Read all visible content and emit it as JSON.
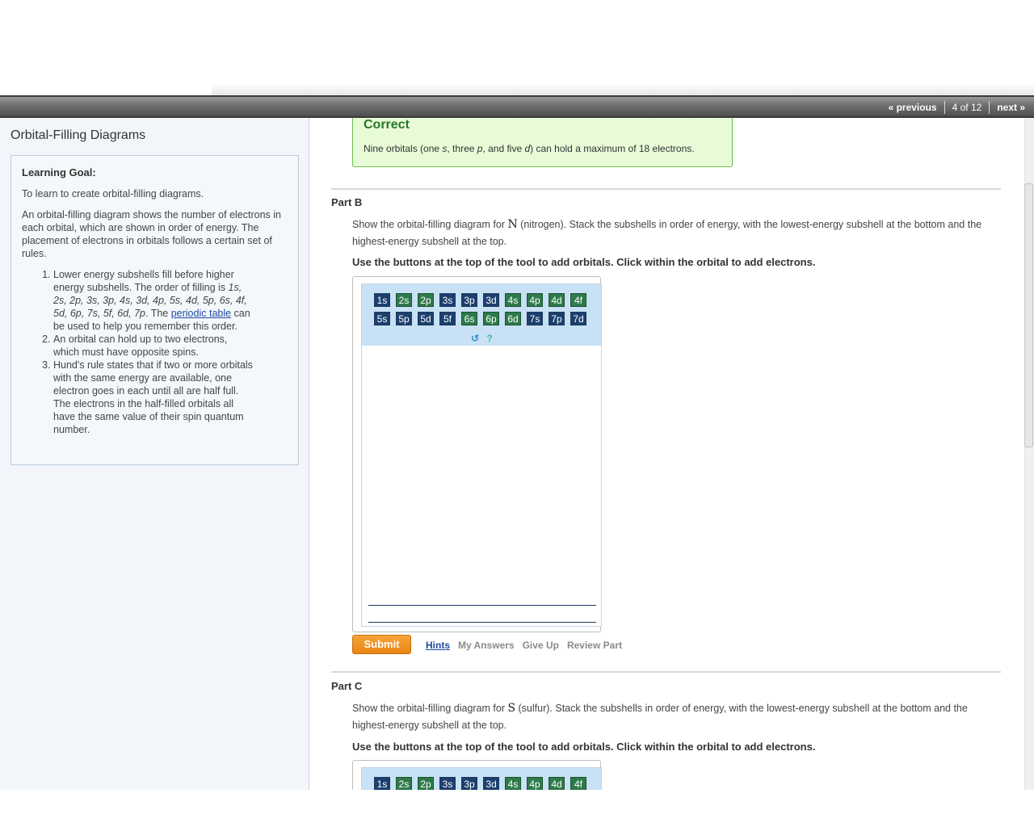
{
  "nav": {
    "previous": "« previous",
    "count": "4 of 12",
    "next": "next »"
  },
  "sidebar": {
    "title": "Orbital-Filling Diagrams",
    "goal_heading": "Learning Goal:",
    "goal_text": "To learn to create orbital-filling diagrams.",
    "intro": "An orbital-filling diagram shows the number of electrons in each orbital, which are shown in order of energy. The placement of electrons in orbitals follows a certain set of rules.",
    "rule1_before": "Lower energy subshells fill before higher energy subshells. The order of filling is ",
    "rule1_order": "1s, 2s, 2p, 3s, 3p, 4s, 3d, 4p, 5s, 4d, 5p, 6s, 4f, 5d, 6p, 7s, 5f, 6d, 7p",
    "rule1_mid": ". The ",
    "rule1_link": "periodic table",
    "rule1_after": " can be used to help you remember this order.",
    "rule2": "An orbital can hold up to two electrons, which must have opposite spins.",
    "rule3": "Hund's rule states that if two or more orbitals with the same energy are available, one electron goes in each until all are half full. The electrons in the half-filled orbitals all have the same value of their spin quantum number."
  },
  "feedback": {
    "title": "Correct",
    "msg_1": "Nine orbitals (one ",
    "msg_s": "s",
    "msg_2": ", three ",
    "msg_p": "p",
    "msg_3": ", and five ",
    "msg_d": "d",
    "msg_4": ") can hold a maximum of 18 electrons."
  },
  "partB": {
    "label": "Part B",
    "desc_before": "Show the orbital-filling diagram for ",
    "element": "N",
    "desc_after": " (nitrogen). Stack the subshells in order of energy, with the lowest-energy subshell at the bottom and the highest-energy subshell at the top.",
    "instruction": "Use the buttons at the top of the tool to add orbitals. Click within the orbital to add electrons.",
    "submit": "Submit",
    "hints": "Hints",
    "my_answers": "My Answers",
    "give_up": "Give Up",
    "review": "Review Part"
  },
  "partC": {
    "label": "Part C",
    "desc_before": "Show the orbital-filling diagram for ",
    "element": "S",
    "desc_after": " (sulfur). Stack the subshells in order of energy, with the lowest-energy subshell at the bottom and the highest-energy subshell at the top.",
    "instruction": "Use the buttons at the top of the tool to add orbitals. Click within the orbital to add electrons."
  },
  "tool": {
    "row1": [
      "1s",
      "2s",
      "2p",
      "3s",
      "3p",
      "3d",
      "4s",
      "4p",
      "4d",
      "4f"
    ],
    "row1_colors": [
      "blue",
      "green",
      "green",
      "blue",
      "blue",
      "blue",
      "green",
      "green",
      "green",
      "green"
    ],
    "row2": [
      "5s",
      "5p",
      "5d",
      "5f",
      "6s",
      "6p",
      "6d",
      "7s",
      "7p",
      "7d"
    ],
    "row2_colors": [
      "blue",
      "blue",
      "blue",
      "blue",
      "green",
      "green",
      "green",
      "blue",
      "blue",
      "blue"
    ],
    "reset_icon": "↺",
    "help_icon": "?"
  },
  "colors": {
    "accent_orange": "#e98514",
    "correct_green": "#27762a",
    "link_blue": "#1f4aa0"
  }
}
